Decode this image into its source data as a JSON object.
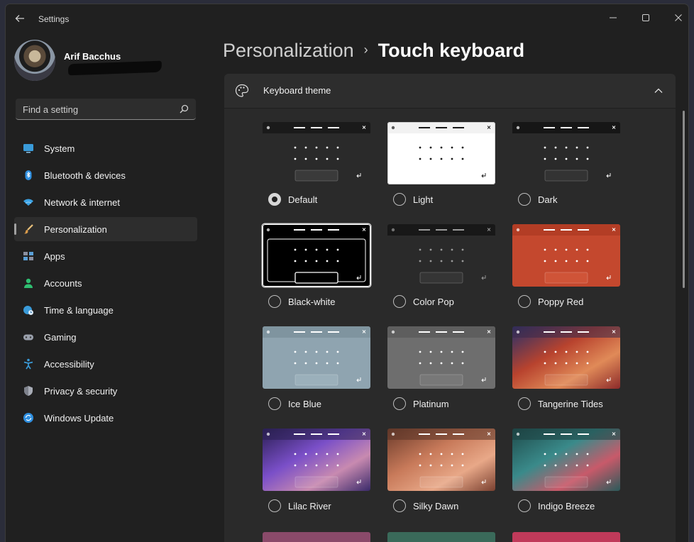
{
  "window": {
    "title": "Settings"
  },
  "user": {
    "name": "Arif Bacchus"
  },
  "search": {
    "placeholder": "Find a setting"
  },
  "nav": {
    "items": [
      {
        "label": "System",
        "icon": "monitor-icon",
        "selected": false
      },
      {
        "label": "Bluetooth & devices",
        "icon": "bluetooth-icon",
        "selected": false
      },
      {
        "label": "Network & internet",
        "icon": "wifi-icon",
        "selected": false
      },
      {
        "label": "Personalization",
        "icon": "brush-icon",
        "selected": true
      },
      {
        "label": "Apps",
        "icon": "apps-icon",
        "selected": false
      },
      {
        "label": "Accounts",
        "icon": "person-icon",
        "selected": false
      },
      {
        "label": "Time & language",
        "icon": "globe-clock-icon",
        "selected": false
      },
      {
        "label": "Gaming",
        "icon": "gamepad-icon",
        "selected": false
      },
      {
        "label": "Accessibility",
        "icon": "accessibility-icon",
        "selected": false
      },
      {
        "label": "Privacy & security",
        "icon": "shield-icon",
        "selected": false
      },
      {
        "label": "Windows Update",
        "icon": "update-icon",
        "selected": false
      }
    ]
  },
  "breadcrumb": {
    "parent": "Personalization",
    "separator": "›",
    "current": "Touch keyboard"
  },
  "panel": {
    "title": "Keyboard theme",
    "expanded": true
  },
  "themes": [
    {
      "label": "Default",
      "selected": true
    },
    {
      "label": "Light",
      "selected": false
    },
    {
      "label": "Dark",
      "selected": false
    },
    {
      "label": "Black-white",
      "selected": false
    },
    {
      "label": "Color Pop",
      "selected": false
    },
    {
      "label": "Poppy Red",
      "selected": false
    },
    {
      "label": "Ice Blue",
      "selected": false
    },
    {
      "label": "Platinum",
      "selected": false
    },
    {
      "label": "Tangerine Tides",
      "selected": false
    },
    {
      "label": "Lilac River",
      "selected": false
    },
    {
      "label": "Silky Dawn",
      "selected": false
    },
    {
      "label": "Indigo Breeze",
      "selected": false
    }
  ],
  "colors": {
    "window_bg": "#202020",
    "panel_bg": "#2a2a2a",
    "accent_system": "#3a9bd9",
    "accent_accounts": "#2fbf71"
  }
}
